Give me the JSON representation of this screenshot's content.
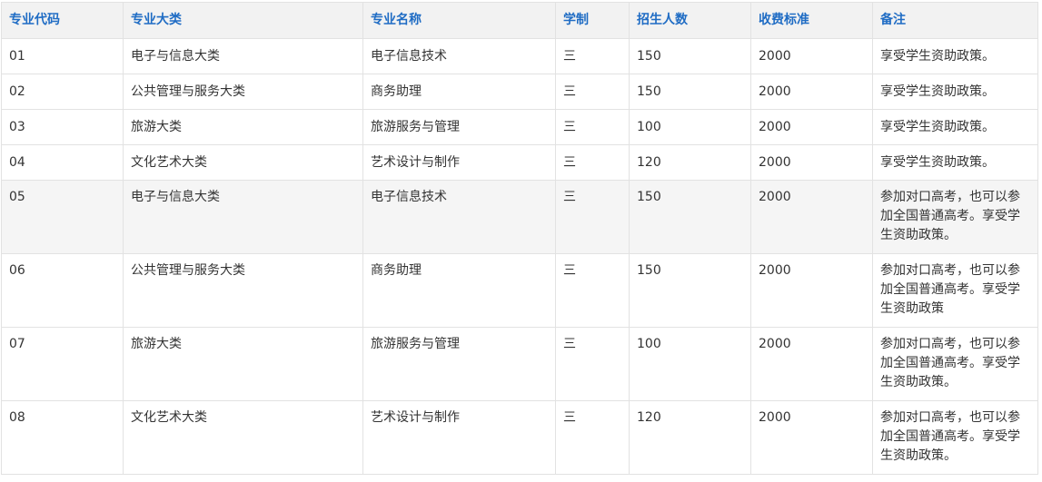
{
  "table": {
    "headers": [
      "专业代码",
      "专业大类",
      "专业名称",
      "学制",
      "招生人数",
      "收费标准",
      "备注"
    ],
    "rows": [
      [
        "01",
        "电子与信息大类",
        "电子信息技术",
        "三",
        "150",
        "2000",
        "享受学生资助政策。"
      ],
      [
        "02",
        "公共管理与服务大类",
        "商务助理",
        "三",
        "150",
        "2000",
        "享受学生资助政策。"
      ],
      [
        "03",
        "旅游大类",
        "旅游服务与管理",
        "三",
        "100",
        "2000",
        "享受学生资助政策。"
      ],
      [
        "04",
        "文化艺术大类",
        "艺术设计与制作",
        "三",
        "120",
        "2000",
        "享受学生资助政策。"
      ],
      [
        "05",
        "电子与信息大类",
        "电子信息技术",
        "三",
        "150",
        "2000",
        "参加对口高考，也可以参加全国普通高考。享受学生资助政策。"
      ],
      [
        "06",
        "公共管理与服务大类",
        "商务助理",
        "三",
        "150",
        "2000",
        "参加对口高考，也可以参加全国普通高考。享受学生资助政策"
      ],
      [
        "07",
        "旅游大类",
        "旅游服务与管理",
        "三",
        "100",
        "2000",
        "参加对口高考，也可以参加全国普通高考。享受学生资助政策。"
      ],
      [
        "08",
        "文化艺术大类",
        "艺术设计与制作",
        "三",
        "120",
        "2000",
        "参加对口高考，也可以参加全国普通高考。享受学生资助政策。"
      ]
    ]
  }
}
